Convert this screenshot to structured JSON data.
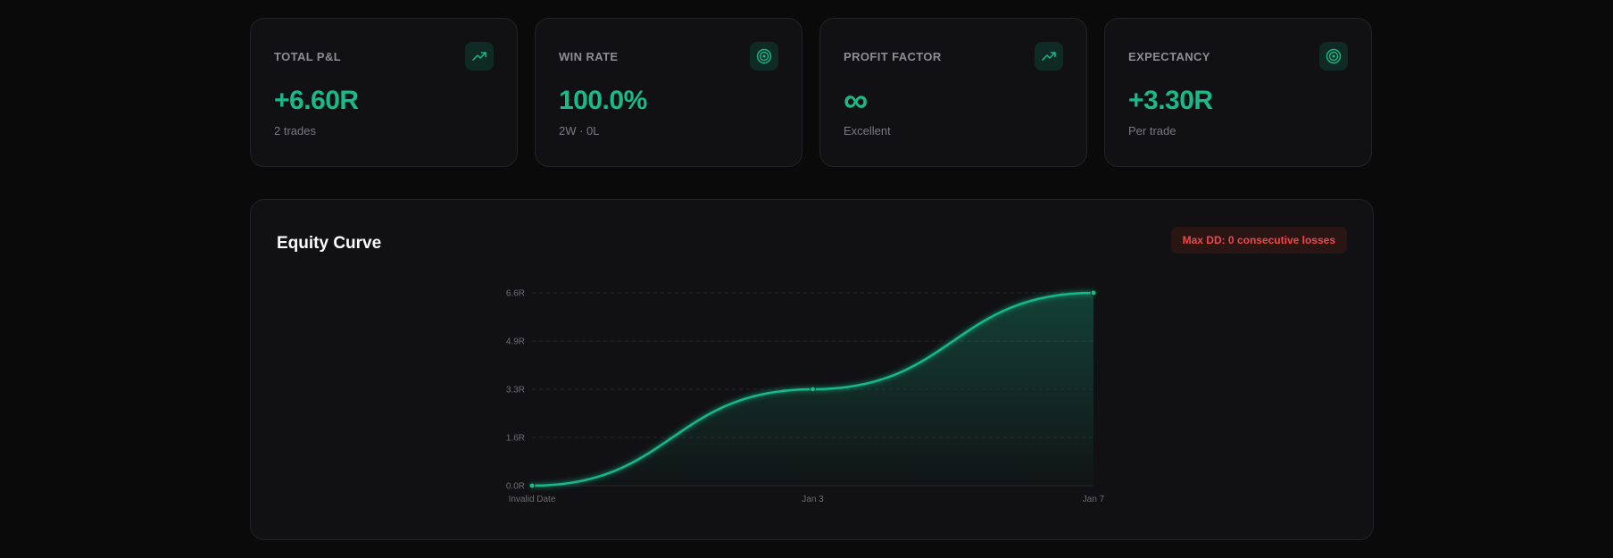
{
  "stats": [
    {
      "label": "TOTAL P&L",
      "value": "+6.60R",
      "sub": "2 trades",
      "icon": "trending-up-icon"
    },
    {
      "label": "WIN RATE",
      "value": "100.0%",
      "sub": "2W · 0L",
      "icon": "target-icon"
    },
    {
      "label": "PROFIT FACTOR",
      "value": "∞",
      "sub": "Excellent",
      "icon": "trending-up-icon"
    },
    {
      "label": "EXPECTANCY",
      "value": "+3.30R",
      "sub": "Per trade",
      "icon": "target-icon"
    }
  ],
  "equity": {
    "title": "Equity Curve",
    "drawdown_badge": "Max DD: 0 consecutive losses"
  },
  "colors": {
    "accent": "#19b98a",
    "danger": "#f04848",
    "background": "#0a0a0b",
    "card": "#111113"
  },
  "chart_data": {
    "type": "area",
    "title": "Equity Curve",
    "categories": [
      "Invalid Date",
      "Jan 3",
      "Jan 7"
    ],
    "values": [
      0.0,
      3.3,
      6.6
    ],
    "ytick_labels": [
      "0.0R",
      "1.6R",
      "3.3R",
      "4.9R",
      "6.6R"
    ],
    "ytick_values": [
      0,
      1.65,
      3.3,
      4.95,
      6.6
    ],
    "ylim": [
      0,
      6.6
    ],
    "grid": true,
    "xlabel": "",
    "ylabel": ""
  }
}
